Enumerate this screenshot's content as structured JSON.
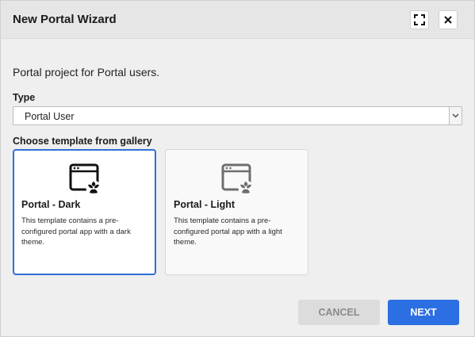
{
  "dialog": {
    "title": "New Portal Wizard",
    "expand_icon": "expand-icon",
    "close_icon": "close-icon"
  },
  "description": "Portal project for Portal users.",
  "type_field": {
    "label": "Type",
    "selected": "Portal User"
  },
  "gallery": {
    "label": "Choose template from gallery",
    "templates": [
      {
        "title": "Portal - Dark",
        "description": "This template contains a pre-configured portal app with a dark theme.",
        "icon": "portal-app-icon",
        "selected": true
      },
      {
        "title": "Portal - Light",
        "description": "This template contains a pre-configured portal app with a light theme.",
        "icon": "portal-app-icon",
        "selected": false
      }
    ]
  },
  "buttons": {
    "cancel": "CANCEL",
    "next": "NEXT"
  },
  "colors": {
    "accent": "#2b6fe3",
    "selected_border": "#2f6fd6",
    "disabled_button": "#dcdcdc"
  }
}
